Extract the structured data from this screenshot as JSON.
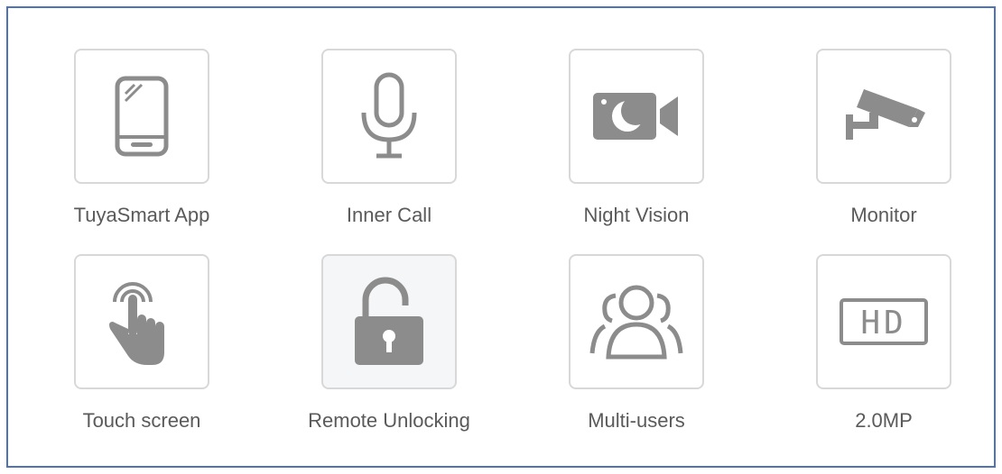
{
  "features": [
    {
      "label": "TuyaSmart App",
      "icon": "smartphone-icon"
    },
    {
      "label": "Inner Call",
      "icon": "microphone-icon"
    },
    {
      "label": "Night Vision",
      "icon": "night-vision-camera-icon"
    },
    {
      "label": "Monitor",
      "icon": "security-camera-icon"
    },
    {
      "label": "Touch screen",
      "icon": "touch-hand-icon"
    },
    {
      "label": "Remote Unlocking",
      "icon": "unlocked-padlock-icon"
    },
    {
      "label": "Multi-users",
      "icon": "users-group-icon"
    },
    {
      "label": "2.0MP",
      "icon": "hd-badge-icon",
      "icon_text": "HD"
    }
  ],
  "colors": {
    "frame_border": "#4f73b5",
    "tile_border": "#d8d8d8",
    "icon_gray": "#8c8c8c",
    "label_gray": "#5a5a5a"
  }
}
